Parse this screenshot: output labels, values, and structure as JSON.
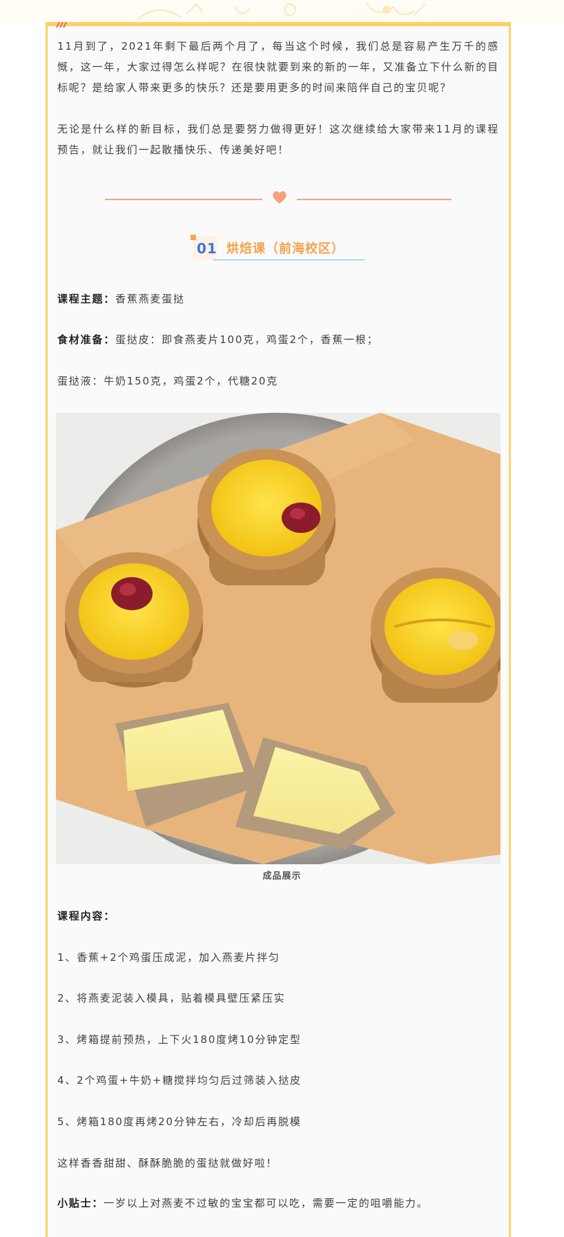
{
  "intro": {
    "para1": "11月到了，2021年剩下最后两个月了，每当这个时候，我们总是容易产生万千的感慨，这一年，大家过得怎么样呢？在很快就要到来的新的一年，又准备立下什么新的目标呢？是给家人带来更多的快乐？还是要用更多的时间来陪伴自己的宝贝呢？",
    "para2": "无论是什么样的新目标，我们总是要努力做得更好！这次继续给大家带来11月的课程预告，就让我们一起散播快乐、传递美好吧！"
  },
  "section": {
    "number": "01",
    "title": "烘焙课（前海校区）"
  },
  "course": {
    "topic_label": "课程主题：",
    "topic_value": "香蕉燕麦蛋挞",
    "ingredients_label": "食材准备：",
    "ingredients_value": "蛋挞皮：即食燕麦片100克，鸡蛋2个，香蕉一根；",
    "liquid": "蛋挞液：牛奶150克，鸡蛋2个，代糖20克"
  },
  "photo": {
    "caption": "成品展示"
  },
  "content": {
    "label": "课程内容：",
    "steps": [
      "1、香蕉+2个鸡蛋压成泥，加入燕麦片拌匀",
      "2、将燕麦泥装入模具，贴着模具壁压紧压实",
      "3、烤箱提前预热，上下火180度烤10分钟定型",
      "4、2个鸡蛋+牛奶+糖搅拌均匀后过筛装入挞皮",
      "5、烤箱180度再烤20分钟左右，冷却后再脱模"
    ],
    "closing": "这样香香甜甜、酥酥脆脆的蛋挞就做好啦！",
    "tip_label": "小贴士：",
    "tip_value": "一岁以上对燕麦不过敏的宝宝都可以吃，需要一定的咀嚼能力。"
  },
  "colors": {
    "border": "#fcd266",
    "divider": "#f1a48a",
    "section_title": "#f7a24a",
    "section_number": "#3b78d8"
  }
}
